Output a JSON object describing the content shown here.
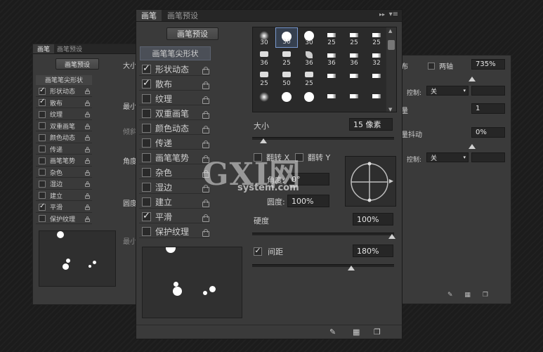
{
  "left_panel": {
    "tabs": [
      "画笔",
      "画笔预设"
    ],
    "preset_button": "画笔预设",
    "tip_shape_header": "画笔笔尖形状",
    "options": [
      {
        "label": "形状动态",
        "checked": true
      },
      {
        "label": "散布",
        "checked": true
      },
      {
        "label": "纹理",
        "checked": false
      },
      {
        "label": "双重画笔",
        "checked": false
      },
      {
        "label": "颜色动态",
        "checked": false
      },
      {
        "label": "传递",
        "checked": false
      },
      {
        "label": "画笔笔势",
        "checked": false
      },
      {
        "label": "杂色",
        "checked": false
      },
      {
        "label": "湿边",
        "checked": false
      },
      {
        "label": "建立",
        "checked": false
      },
      {
        "label": "平滑",
        "checked": true
      },
      {
        "label": "保护纹理",
        "checked": false
      }
    ],
    "cut_labels": [
      "大小",
      "最小",
      "倾斜",
      "角度",
      "圆度",
      "最小"
    ]
  },
  "right_panel": {
    "partial_labels": [
      "布",
      "量",
      "量抖动"
    ],
    "both_axes_label": "两轴",
    "scatter_value": "735%",
    "control_label_1": "控制:",
    "control_value_1": "关",
    "count_value": "1",
    "count_jitter_value": "0%",
    "control_label_2": "控制:",
    "control_value_2": "关"
  },
  "main_panel": {
    "tabs": [
      "画笔",
      "画笔预设"
    ],
    "preset_button": "画笔预设",
    "tip_shape_header": "画笔笔尖形状",
    "options": [
      {
        "label": "形状动态",
        "checked": true
      },
      {
        "label": "散布",
        "checked": true
      },
      {
        "label": "纹理",
        "checked": false
      },
      {
        "label": "双重画笔",
        "checked": false
      },
      {
        "label": "颜色动态",
        "checked": false
      },
      {
        "label": "传递",
        "checked": false
      },
      {
        "label": "画笔笔势",
        "checked": false
      },
      {
        "label": "杂色",
        "checked": false
      },
      {
        "label": "湿边",
        "checked": false
      },
      {
        "label": "建立",
        "checked": false
      },
      {
        "label": "平滑",
        "checked": true
      },
      {
        "label": "保护纹理",
        "checked": false
      }
    ],
    "brush_sizes": [
      "30",
      "30",
      "30",
      "25",
      "25",
      "25",
      "36",
      "25",
      "36",
      "36",
      "36",
      "32",
      "25",
      "50",
      "25"
    ],
    "size_label": "大小",
    "size_value": "15 像素",
    "flip_x_label": "翻转 X",
    "flip_y_label": "翻转 Y",
    "angle_label": "角度:",
    "angle_value": "0°",
    "roundness_label": "圆度:",
    "roundness_value": "100%",
    "hardness_label": "硬度",
    "hardness_value": "100%",
    "spacing_label": "间距",
    "spacing_checked": true,
    "spacing_value": "180%"
  },
  "watermark": {
    "logo_text": "GXI网",
    "domain_text": "system.com"
  },
  "icon_names": [
    "menu-icon",
    "lock-icon",
    "brush-toggle-icon",
    "grid-icon",
    "new-preset-icon",
    "play-arrow-icon"
  ]
}
